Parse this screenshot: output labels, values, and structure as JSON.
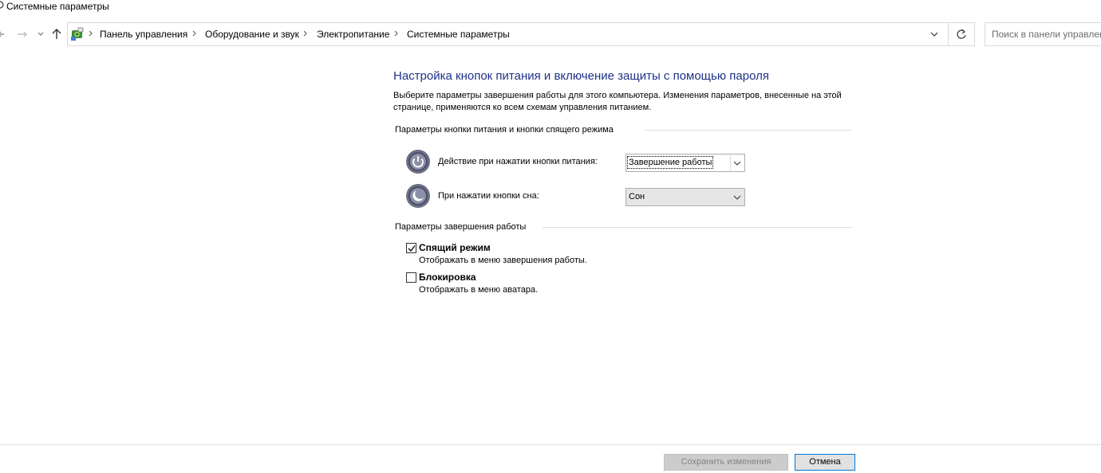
{
  "window": {
    "title": "Системные параметры"
  },
  "address_bar": {
    "breadcrumbs": [
      "Панель управления",
      "Оборудование и звук",
      "Электропитание",
      "Системные параметры"
    ]
  },
  "search": {
    "placeholder": "Поиск в панели управления"
  },
  "main": {
    "heading": "Настройка кнопок питания и включение защиты с помощью пароля",
    "description": "Выберите параметры завершения работы для этого компьютера. Изменения параметров, внесенные на этой странице, применяются ко всем схемам управления питанием.",
    "power_buttons_group": {
      "title": "Параметры кнопки питания и кнопки спящего режима",
      "rows": [
        {
          "icon": "power-icon",
          "label": "Действие при нажатии кнопки питания:",
          "selected": "Завершение работы"
        },
        {
          "icon": "sleep-icon",
          "label": "При нажатии кнопки сна:",
          "selected": "Сон"
        }
      ]
    },
    "shutdown_group": {
      "title": "Параметры завершения работы",
      "options": [
        {
          "label": "Спящий режим",
          "description": "Отображать в меню завершения работы.",
          "checked": true
        },
        {
          "label": "Блокировка",
          "description": "Отображать в меню аватара.",
          "checked": false
        }
      ]
    }
  },
  "footer": {
    "save_label": "Сохранить изменения",
    "save_enabled": false,
    "cancel_label": "Отмена"
  },
  "colors": {
    "heading": "#1e3287",
    "group_line": "#d5dfe5",
    "focus_border": "#0078d7"
  }
}
